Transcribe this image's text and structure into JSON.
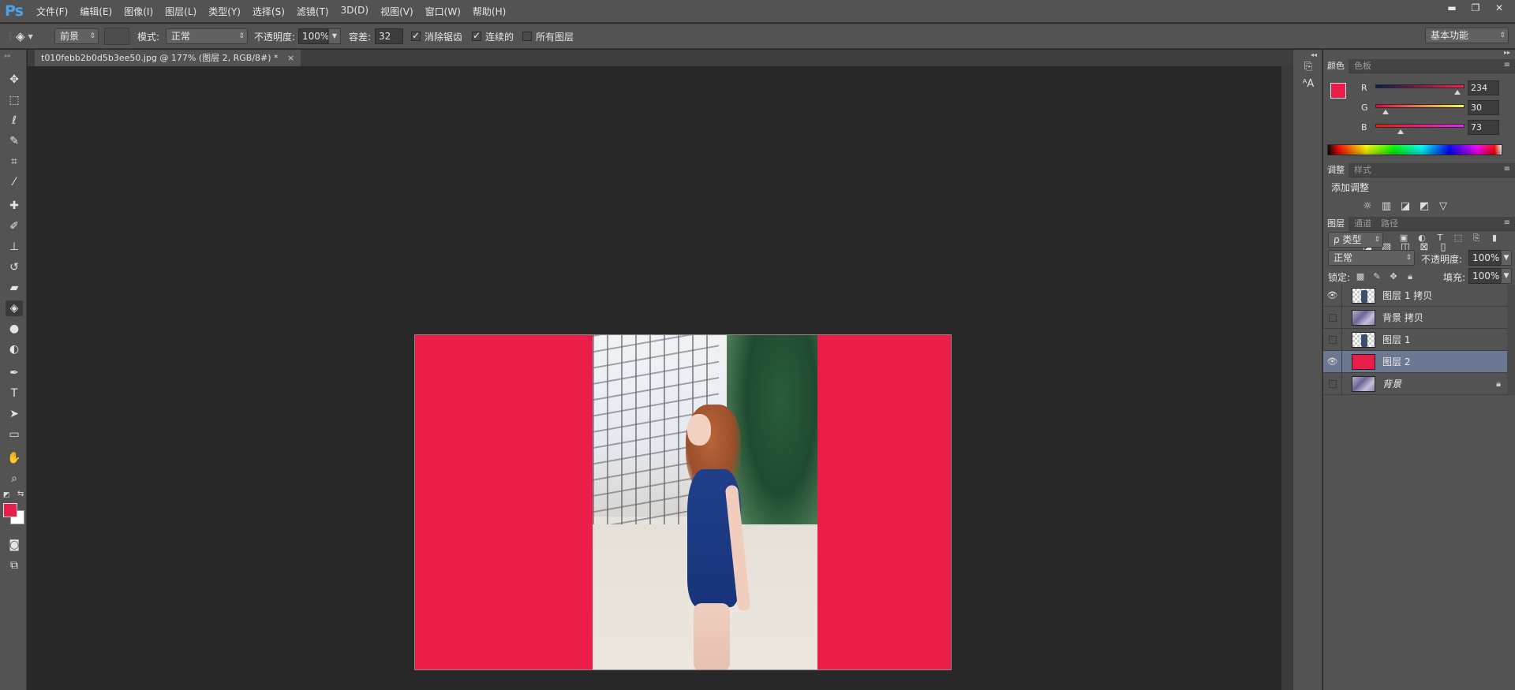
{
  "app": {
    "logo": "Ps",
    "menu": [
      "文件(F)",
      "编辑(E)",
      "图像(I)",
      "图层(L)",
      "类型(Y)",
      "选择(S)",
      "滤镜(T)",
      "3D(D)",
      "视图(V)",
      "窗口(W)",
      "帮助(H)"
    ],
    "window_controls": {
      "minimize": "▬",
      "restore": "❐",
      "close": "✕"
    }
  },
  "options": {
    "fill_source": "前景",
    "mode_label": "模式:",
    "mode_value": "正常",
    "opacity_label": "不透明度:",
    "opacity_value": "100%",
    "tolerance_label": "容差:",
    "tolerance_value": "32",
    "antialias_label": "消除锯齿",
    "antialias_checked": true,
    "contiguous_label": "连续的",
    "contiguous_checked": true,
    "all_layers_label": "所有图层",
    "all_layers_checked": false,
    "workspace": "基本功能"
  },
  "document": {
    "tab_title": "t010febb2b0d5b3ee50.jpg @ 177% (图层 2, RGB/8#) *",
    "close": "×"
  },
  "tools": [
    {
      "name": "move-tool",
      "icon": "move-icon",
      "glyph": "✥"
    },
    {
      "name": "marquee-tool",
      "icon": "marquee-icon",
      "glyph": "⬚"
    },
    {
      "name": "lasso-tool",
      "icon": "lasso-icon",
      "glyph": "ℓ"
    },
    {
      "name": "quick-select-tool",
      "icon": "quick-select-icon",
      "glyph": "✎"
    },
    {
      "name": "crop-tool",
      "icon": "crop-icon",
      "glyph": "⌗"
    },
    {
      "name": "eyedropper-tool",
      "icon": "eyedropper-icon",
      "glyph": "⁄"
    },
    {
      "name": "healing-tool",
      "icon": "bandage-icon",
      "glyph": "✚"
    },
    {
      "name": "brush-tool",
      "icon": "brush-icon",
      "glyph": "✐"
    },
    {
      "name": "stamp-tool",
      "icon": "stamp-icon",
      "glyph": "⊥"
    },
    {
      "name": "history-brush-tool",
      "icon": "history-brush-icon",
      "glyph": "↺"
    },
    {
      "name": "eraser-tool",
      "icon": "eraser-icon",
      "glyph": "▰"
    },
    {
      "name": "paint-bucket-tool",
      "icon": "paint-bucket-icon",
      "glyph": "◈"
    },
    {
      "name": "blur-tool",
      "icon": "drop-icon",
      "glyph": "●"
    },
    {
      "name": "dodge-tool",
      "icon": "dodge-icon",
      "glyph": "◐"
    },
    {
      "name": "pen-tool",
      "icon": "pen-icon",
      "glyph": "✒"
    },
    {
      "name": "type-tool",
      "icon": "type-icon",
      "glyph": "T"
    },
    {
      "name": "path-select-tool",
      "icon": "arrow-icon",
      "glyph": "➤"
    },
    {
      "name": "shape-tool",
      "icon": "rectangle-icon",
      "glyph": "▭"
    },
    {
      "name": "hand-tool",
      "icon": "hand-icon",
      "glyph": "✋"
    },
    {
      "name": "zoom-tool",
      "icon": "zoom-icon",
      "glyph": "⌕"
    }
  ],
  "colors": {
    "foreground": "#ea1e49",
    "background": "#ffffff",
    "accent": "#ea1e49"
  },
  "panels": {
    "color": {
      "tabs": [
        "颜色",
        "色板"
      ],
      "channels": [
        {
          "label": "R",
          "value": "234",
          "fraction": 0.918
        },
        {
          "label": "G",
          "value": "30",
          "fraction": 0.118
        },
        {
          "label": "B",
          "value": "73",
          "fraction": 0.286
        }
      ]
    },
    "adjustments": {
      "tabs": [
        "调整",
        "样式"
      ],
      "title": "添加调整"
    },
    "layers": {
      "tabs": [
        "图层",
        "通道",
        "路径"
      ],
      "filter": "ρ 类型",
      "blend_mode": "正常",
      "opacity_label": "不透明度:",
      "opacity_value": "100%",
      "lock_label": "锁定:",
      "fill_label": "填充:",
      "fill_value": "100%",
      "items": [
        {
          "name": "图层 1 拷贝",
          "visible": true,
          "thumb": "check"
        },
        {
          "name": "背景 拷贝",
          "visible": false,
          "thumb": "photo"
        },
        {
          "name": "图层 1",
          "visible": false,
          "thumb": "check"
        },
        {
          "name": "图层 2",
          "visible": true,
          "thumb": "red",
          "selected": true
        },
        {
          "name": "背景",
          "visible": false,
          "thumb": "photo",
          "locked": true
        }
      ]
    }
  }
}
